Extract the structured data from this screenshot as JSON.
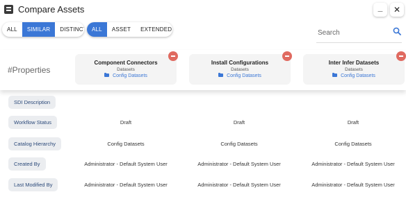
{
  "window": {
    "title": "Compare Assets",
    "minimize_label": "_",
    "close_label": "✕"
  },
  "filters": {
    "mode": [
      {
        "label": "ALL",
        "active": false
      },
      {
        "label": "SIMILAR",
        "active": true
      },
      {
        "label": "DISTINCT",
        "active": false
      }
    ],
    "scope": [
      {
        "label": "ALL",
        "active": true
      },
      {
        "label": "ASSET",
        "active": false
      },
      {
        "label": "EXTENDED",
        "active": false
      }
    ]
  },
  "search": {
    "placeholder": "Search",
    "value": ""
  },
  "properties_title": "#Properties",
  "assets": [
    {
      "name": "Component Connectors",
      "type": "Datasets",
      "folder": "Config Datasets"
    },
    {
      "name": "Install Configurations",
      "type": "Datasets",
      "folder": "Config Datasets"
    },
    {
      "name": "Inter Infer Datasets",
      "type": "Datasets",
      "folder": "Config Datasets"
    }
  ],
  "rows": [
    {
      "label": "SDI Description",
      "values": [
        "",
        "",
        ""
      ]
    },
    {
      "label": "Workflow Status",
      "values": [
        "Draft",
        "Draft",
        "Draft"
      ]
    },
    {
      "label": "Catalog Hierarchy",
      "values": [
        "Config Datasets",
        "Config Datasets",
        "Config Datasets"
      ]
    },
    {
      "label": "Created By",
      "values": [
        "Administrator - Default System User",
        "Administrator - Default System User",
        "Administrator - Default System User"
      ]
    },
    {
      "label": "Last Modified By",
      "values": [
        "Administrator - Default System User",
        "Administrator - Default System User",
        "Administrator - Default System User"
      ]
    }
  ],
  "colors": {
    "accent": "#3b77d6",
    "remove": "#e06a60",
    "label_bg": "#ebedf0"
  }
}
